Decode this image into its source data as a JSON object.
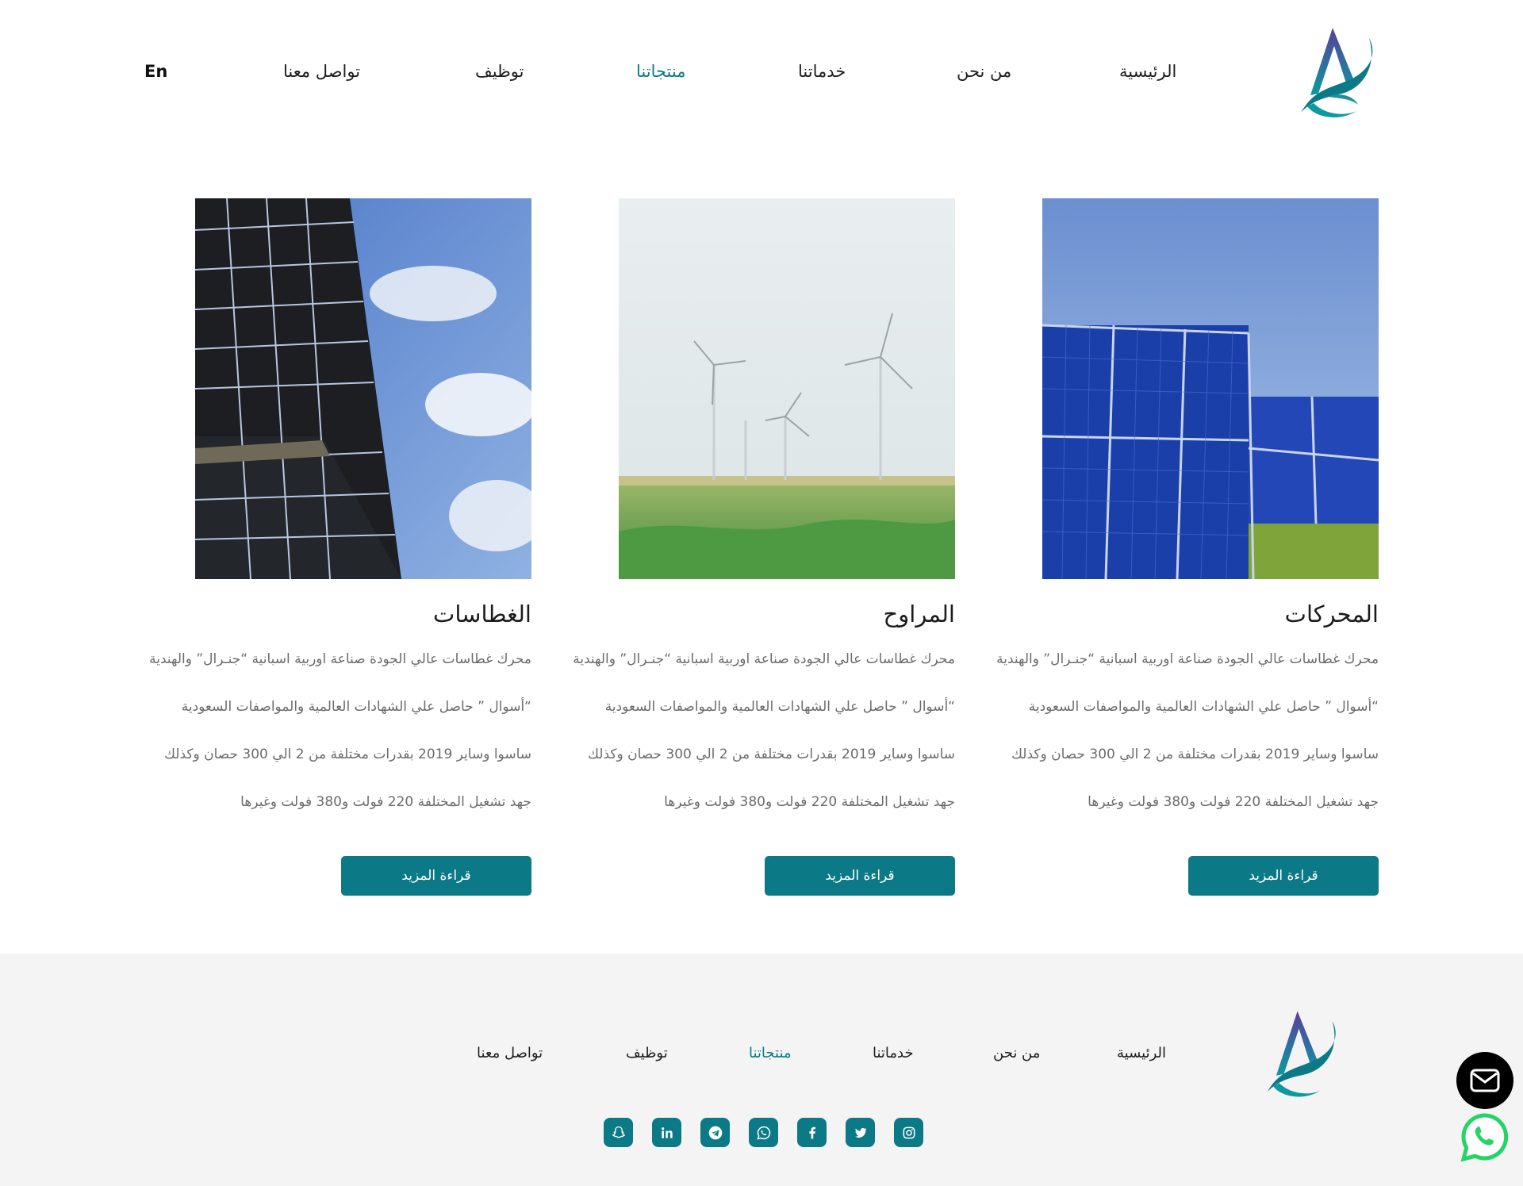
{
  "header": {
    "nav": [
      {
        "label": "الرئيسية",
        "active": false
      },
      {
        "label": "من نحن",
        "active": false
      },
      {
        "label": "خدماتنا",
        "active": false
      },
      {
        "label": "منتجاتنا",
        "active": true
      },
      {
        "label": "توظيف",
        "active": false
      },
      {
        "label": "تواصل معنا",
        "active": false
      }
    ],
    "lang": "En"
  },
  "products": [
    {
      "title": "المحركات",
      "image": "solar-panels-field",
      "lines": [
        "محرك غطاسات عالي الجودة صناعة اوربية اسبانية “جنـرال” والهندية",
        "“أسوال ” حاصل علي الشهادات العالمية والمواصفات السعودية",
        "ساسوا وساير 2019 بقدرات مختلفة من 2 الي 300 حصان وكذلك",
        "جهد تشغيل المختلفة 220 فولت و380 فولت وغيرها"
      ],
      "button": "قراءة المزيد"
    },
    {
      "title": "المراوح",
      "image": "wind-turbines",
      "lines": [
        "محرك غطاسات عالي الجودة صناعة اوربية اسبانية “جنـرال” والهندية",
        "“أسوال ” حاصل علي الشهادات العالمية والمواصفات السعودية",
        "ساسوا وساير 2019 بقدرات مختلفة من 2 الي 300 حصان وكذلك",
        "جهد تشغيل المختلفة 220 فولت و380 فولت وغيرها"
      ],
      "button": "قراءة المزيد"
    },
    {
      "title": "الغطاسات",
      "image": "solar-panel-sky",
      "lines": [
        "محرك غطاسات عالي الجودة صناعة اوربية اسبانية “جنـرال” والهندية",
        "“أسوال ” حاصل علي الشهادات العالمية والمواصفات السعودية",
        "ساسوا وساير 2019 بقدرات مختلفة من 2 الي 300 حصان وكذلك",
        "جهد تشغيل المختلفة 220 فولت و380 فولت وغيرها"
      ],
      "button": "قراءة المزيد"
    }
  ],
  "footer": {
    "nav": [
      {
        "label": "الرئيسية",
        "active": false
      },
      {
        "label": "من نحن",
        "active": false
      },
      {
        "label": "خدماتنا",
        "active": false
      },
      {
        "label": "منتجاتنا",
        "active": true
      },
      {
        "label": "توظيف",
        "active": false
      },
      {
        "label": "تواصل معنا",
        "active": false
      }
    ],
    "socials": [
      "snapchat-icon",
      "linkedin-icon",
      "telegram-icon",
      "whatsapp-icon",
      "facebook-icon",
      "twitter-icon",
      "instagram-icon"
    ]
  },
  "floating": {
    "mail_icon": "envelope-icon",
    "whatsapp_icon": "whatsapp-icon"
  },
  "colors": {
    "accent": "#0b7a86",
    "footer_bg": "#f4f4f4",
    "text_muted": "#6b6b6b"
  }
}
